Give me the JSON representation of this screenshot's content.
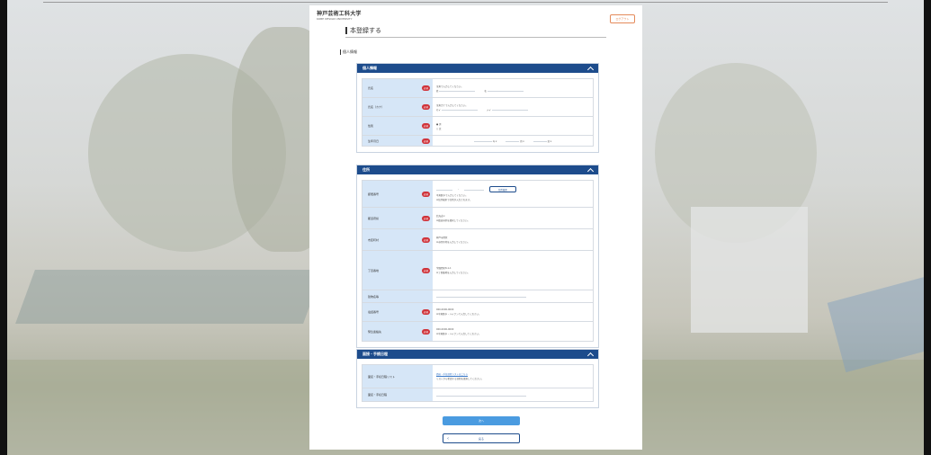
{
  "header": {
    "logo_name": "神戸芸術工科大学",
    "logo_sub": "KOBE DESIGN UNIVERSITY",
    "logout_label": "ログアウト"
  },
  "page": {
    "title": "本登録する",
    "section_label": "個人情報"
  },
  "sections": {
    "personal": {
      "title": "個人情報",
      "rows": [
        {
          "label": "氏名",
          "required": "必須",
          "hint": "全角で入力してください。",
          "field1": "姓",
          "field2": "名"
        },
        {
          "label": "氏名（カナ）",
          "required": "必須",
          "hint": "全角カナで入力してください。",
          "field1": "セイ",
          "field2": "メイ"
        },
        {
          "label": "性別",
          "required": "必須",
          "opt1": "男",
          "opt2": "女"
        },
        {
          "label": "生年月日",
          "required": "必須",
          "year": "年",
          "month": "月",
          "day": "日"
        }
      ]
    },
    "address": {
      "title": "住所",
      "rows": [
        {
          "label": "郵便番号",
          "required": "必須",
          "search": "住所検索",
          "hint1": "半角数字で入力してください。",
          "hint2": "※住所検索で住所が入力されます。"
        },
        {
          "label": "都道府県",
          "required": "必須",
          "select": "北海道",
          "hint": "※都道府県を選択してください。"
        },
        {
          "label": "市区町村",
          "required": "必須",
          "value": "神戸市西区",
          "hint": "※市区町村を入力してください。"
        },
        {
          "label": "丁目番地",
          "required": "必須",
          "value": "学園西町8-1-1",
          "hint": "※丁目番地を入力してください。"
        },
        {
          "label": "建物名等",
          "required": "",
          "value": ""
        },
        {
          "label": "電話番号",
          "required": "必須",
          "value": "000-0000-0000",
          "hint": "※半角数字・ハイフンで入力してください。"
        },
        {
          "label": "緊急連絡先",
          "required": "必須",
          "value": "000-0000-0000",
          "hint": "※半角数字・ハイフンで入力してください。"
        }
      ]
    },
    "schedule": {
      "title": "面接・手続日程",
      "rows": [
        {
          "label": "面接・手続日程リスト",
          "link": "面接・手続日程リストはこちら",
          "hint": "リストから希望する日程を選択してください。"
        },
        {
          "label": "面接・手続日程",
          "value": ""
        }
      ]
    }
  },
  "footer": {
    "next_label": "次へ",
    "back_label": "戻る"
  }
}
